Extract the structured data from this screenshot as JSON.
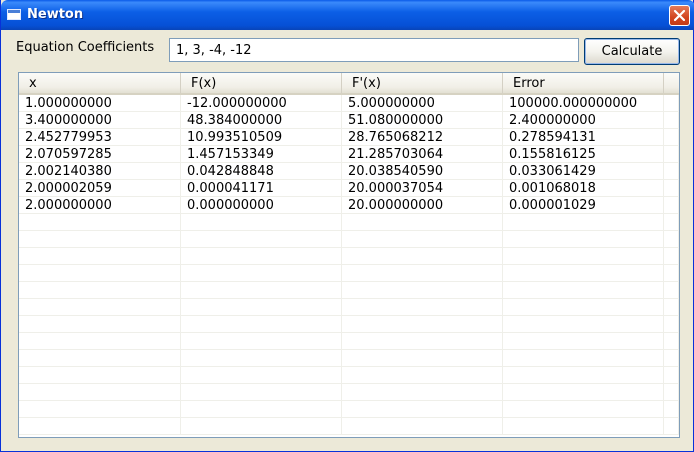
{
  "window": {
    "title": "Newton"
  },
  "form": {
    "coefficients_label": "Equation Coefficients",
    "coefficients_value": "1, 3, -4, -12",
    "calculate_label": "Calculate"
  },
  "table": {
    "columns": [
      "x",
      "F(x)",
      "F'(x)",
      "Error"
    ],
    "rows": [
      [
        "1.000000000",
        "-12.000000000",
        "5.000000000",
        "100000.000000000"
      ],
      [
        "3.400000000",
        "48.384000000",
        "51.080000000",
        "2.400000000"
      ],
      [
        "2.452779953",
        "10.993510509",
        "28.765068212",
        "0.278594131"
      ],
      [
        "2.070597285",
        "1.457153349",
        "21.285703064",
        "0.155816125"
      ],
      [
        "2.002140380",
        "0.042848848",
        "20.038540590",
        "0.033061429"
      ],
      [
        "2.000002059",
        "0.000041171",
        "20.000037054",
        "0.001068018"
      ],
      [
        "2.000000000",
        "0.000000000",
        "20.000000000",
        "0.000001029"
      ]
    ]
  },
  "colors": {
    "titlebar": "#0c5fe6",
    "window_bg": "#ece9d8",
    "close_button": "#d2451f"
  }
}
